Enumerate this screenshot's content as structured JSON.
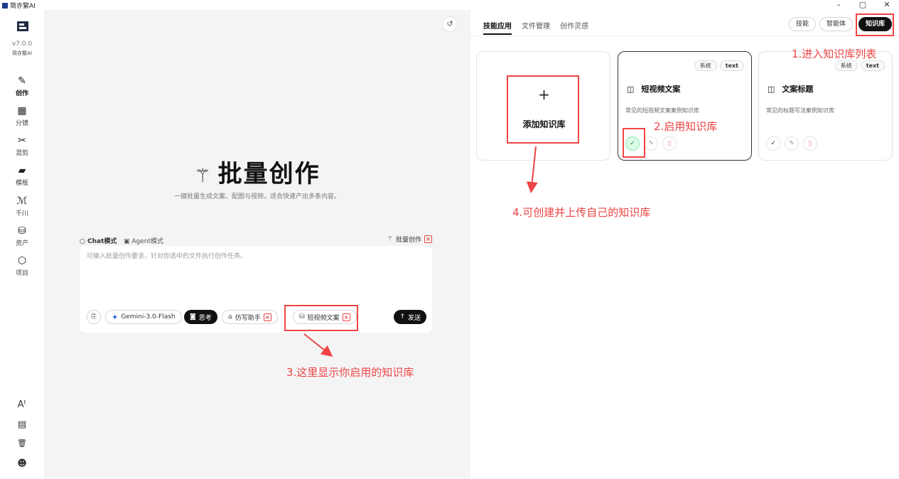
{
  "window": {
    "app_title": "简亦繁AI",
    "controls": [
      "–",
      "▢",
      "✕"
    ]
  },
  "sidebar": {
    "version": "v7.0.0",
    "brand": "简亦繁AI",
    "items": [
      {
        "icon": "pen-icon",
        "glyph": "✎",
        "label": "创作",
        "active": true
      },
      {
        "icon": "storyboard-icon",
        "glyph": "▦",
        "label": "分镜"
      },
      {
        "icon": "scissors-icon",
        "glyph": "✂",
        "label": "混剪"
      },
      {
        "icon": "template-icon",
        "glyph": "▰",
        "label": "模板"
      },
      {
        "icon": "qianchuan-icon",
        "glyph": "ℳ",
        "label": "千川"
      },
      {
        "icon": "assets-icon",
        "glyph": "⛁",
        "label": "资产"
      },
      {
        "icon": "project-icon",
        "glyph": "⬡",
        "label": "项目"
      }
    ],
    "bottom": [
      {
        "icon": "font-size-icon",
        "glyph": "Aᵗ"
      },
      {
        "icon": "card-icon",
        "glyph": "▤"
      },
      {
        "icon": "trash-icon",
        "glyph": "🗑"
      },
      {
        "icon": "user-icon",
        "glyph": "☻"
      }
    ]
  },
  "main": {
    "history_glyph": "↺",
    "title": "批量创作",
    "subtitle": "一键批量生成文案、配图与视频，适合快速产出多条内容。",
    "modes": {
      "chat": "Chat模式",
      "agent": "Agent模式"
    },
    "batch_tag": "批量创作",
    "placeholder": "可输入批量创作要求，针对你选中的文件执行创作任务。",
    "model": "Gemini-3.0-Flash",
    "think": "思考",
    "assistant": "仿写助手",
    "knowledge_chip": "短视频文案",
    "send": "发送"
  },
  "right": {
    "tabs": [
      "技能应用",
      "文件管理",
      "创作灵感"
    ],
    "segments": [
      "技能",
      "智能体",
      "知识库"
    ],
    "add_card": {
      "plus": "+",
      "label": "添加知识库"
    },
    "cards": [
      {
        "tags": [
          "系统",
          "text"
        ],
        "title": "短视频文案",
        "desc": "常见的短视频文案案例知识库",
        "enabled": true
      },
      {
        "tags": [
          "系统",
          "text"
        ],
        "title": "文案标题",
        "desc": "常见的标题写法案例知识库",
        "enabled": false
      }
    ]
  },
  "annotations": {
    "a1": "1.进入知识库列表",
    "a2": "2.启用知识库",
    "a3": "3.这里显示你启用的知识库",
    "a4": "4.可创建并上传自己的知识库"
  },
  "colors": {
    "annotation": "#ef4444",
    "accent_dark": "#111111",
    "enabled_green": "#dcfce7"
  }
}
